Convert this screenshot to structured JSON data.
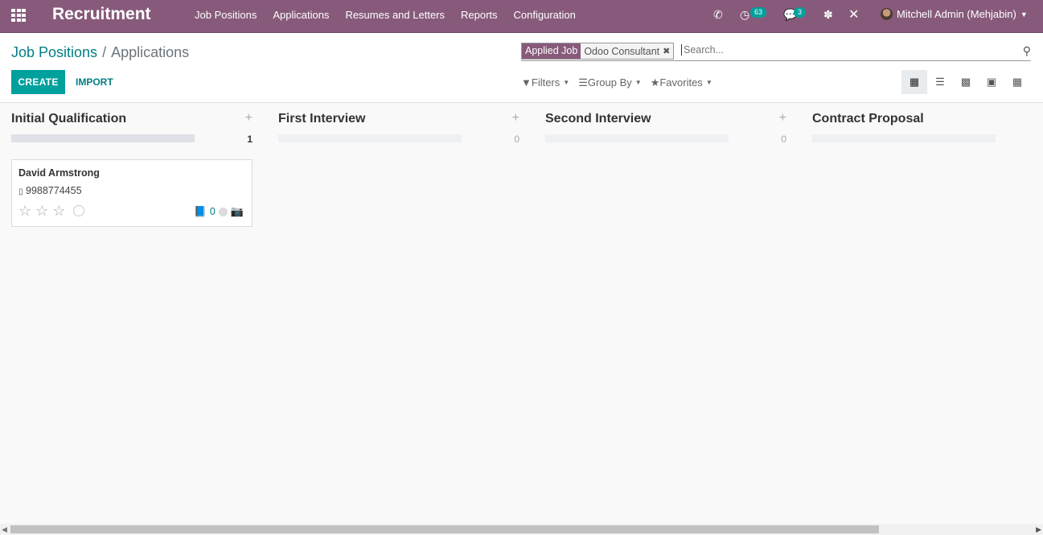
{
  "navbar": {
    "app_name": "Recruitment",
    "menu": [
      "Job Positions",
      "Applications",
      "Resumes and Letters",
      "Reports",
      "Configuration"
    ],
    "activities_badge": "63",
    "messages_badge": "3",
    "user": "Mitchell Admin (Mehjabin)"
  },
  "breadcrumb": {
    "parent": "Job Positions",
    "separator": "/",
    "current": "Applications"
  },
  "buttons": {
    "create": "CREATE",
    "import": "IMPORT"
  },
  "search": {
    "facet_category": "Applied Job",
    "facet_value": "Odoo Consultant",
    "placeholder": "Search..."
  },
  "filters": {
    "filters": "Filters",
    "group_by": "Group By",
    "favorites": "Favorites"
  },
  "views": [
    "kanban",
    "list",
    "graph",
    "calendar",
    "pivot"
  ],
  "columns": [
    {
      "title": "Initial Qualification",
      "count": "1"
    },
    {
      "title": "First Interview",
      "count": "0"
    },
    {
      "title": "Second Interview",
      "count": "0"
    },
    {
      "title": "Contract Proposal",
      "count": ""
    }
  ],
  "card": {
    "name": "David Armstrong",
    "phone": "9988774455",
    "attachments": "0",
    "priority_stars": 0,
    "max_stars": 3
  }
}
